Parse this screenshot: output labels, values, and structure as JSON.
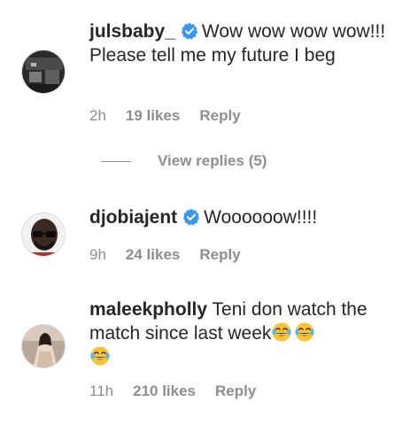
{
  "colors": {
    "text": "#262626",
    "muted": "#8e8e8e",
    "verified": "#3897f0",
    "divider": "#8e8e8e"
  },
  "comments": [
    {
      "username": "julsbaby_",
      "verified": true,
      "text": "Wow wow wow wow!!! Please tell me my future I beg",
      "time": "2h",
      "likes": "19 likes",
      "reply": "Reply",
      "avatar_icon": "avatar-photo"
    },
    {
      "username": "djobiajent",
      "verified": true,
      "text": "Woooooow!!!!",
      "time": "9h",
      "likes": "24 likes",
      "reply": "Reply",
      "avatar_icon": "avatar-photo"
    },
    {
      "username": "maleekpholly",
      "verified": false,
      "text": "Teni don watch the match since last week",
      "emojis": [
        "face-with-tears-of-joy-emoji",
        "face-with-tears-of-joy-emoji",
        "face-with-tears-of-joy-emoji"
      ],
      "time": "11h",
      "likes": "210 likes",
      "reply": "Reply",
      "avatar_icon": "avatar-photo"
    }
  ],
  "view_replies": "View replies (5)"
}
